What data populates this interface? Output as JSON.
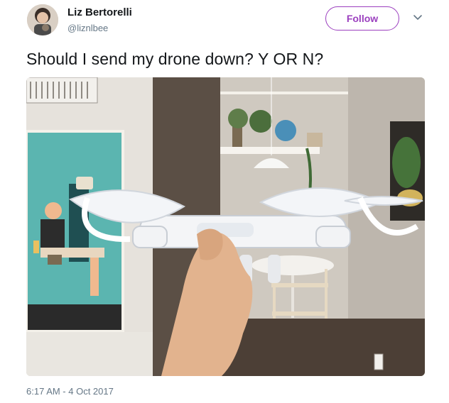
{
  "tweet": {
    "author_name": "Liz Bertorelli",
    "author_handle": "@liznlbee",
    "follow_label": "Follow",
    "text": "Should I send my drone down? Y OR N?",
    "timestamp": "6:17 AM - 4 Oct 2017"
  },
  "colors": {
    "follow_accent": "#9b3fbf",
    "secondary_text": "#657786",
    "primary_text": "#14171a"
  },
  "icons": {
    "more_menu": "chevron-down-icon"
  }
}
